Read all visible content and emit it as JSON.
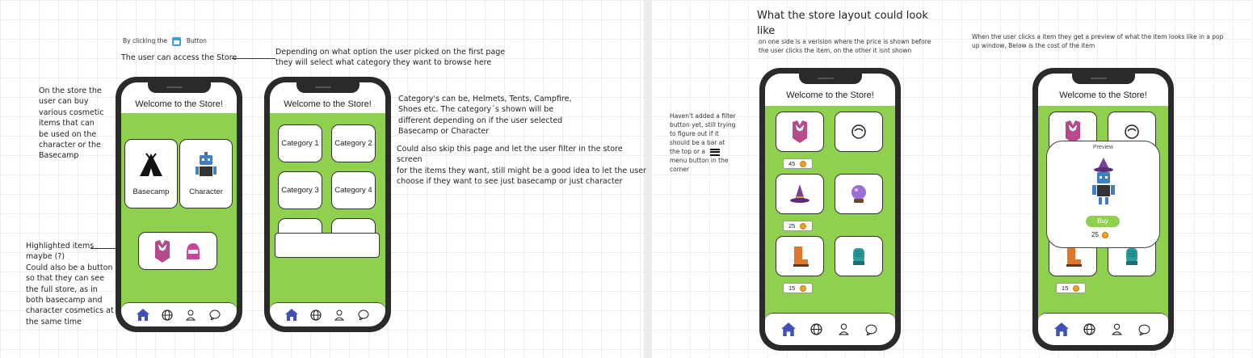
{
  "notes": {
    "by_clicking": "By clicking the",
    "by_clicking_button": "Button",
    "access_store": "The user can access the Store",
    "depending_1": "Depending on what option the user picked on the first page",
    "depending_2": "they will select what category they want to browse here",
    "left_desc": [
      "On the store the",
      "user can buy",
      "various cosmetic",
      "items that can",
      "be used on the",
      "character or the",
      "Basecamp"
    ],
    "category_desc": [
      "Category's can be, Helmets, Tents, Campfire,",
      "Shoes etc. The category´s shown will be",
      "different depending on if the user selected",
      "Basecamp or Character"
    ],
    "skip_desc": [
      "Could also skip this page and let the user filter in the store",
      "screen",
      "for the items they want, still might be a good idea to let the user",
      "choose if they want to see just basecamp or just character"
    ],
    "highlighted": [
      "Highlighted items",
      "maybe (?)",
      "Could also be a button",
      "so that they can see",
      "the full store, as in",
      "both basecamp and",
      "character cosmetics at",
      "the same time"
    ],
    "layout_title_1": "What the store layout could look",
    "layout_title_2": "like",
    "layout_sub": [
      "on one side is a verision where the price is shown before",
      "the user clicks the item, on the other it isnt shown"
    ],
    "popup_desc": [
      "When the user clicks a item they get a preview of what the item looks like in a pop",
      "up window, Below is the cost of the item"
    ],
    "filter_desc": [
      "Haven't added a filter",
      "button yet, still trying",
      "to figure out if it",
      "should be a bar at",
      "the top or a",
      "menu button in the",
      "corner"
    ]
  },
  "store": {
    "welcome": "Welcome to the Store!",
    "basecamp": "Basecamp",
    "character": "Character",
    "categories": [
      "Category 1",
      "Category 2",
      "Category 3",
      "Category 4"
    ],
    "prices": [
      "45",
      "25",
      "15"
    ],
    "preview_title": "Preview",
    "buy": "Buy",
    "preview_price": "25"
  },
  "nav_icons": [
    "home-icon",
    "globe-icon",
    "profile-icon",
    "chat-icon"
  ],
  "colors": {
    "screen_green": "#8fd14f",
    "nav_blue": "#3f51b5",
    "coin": "#f0a020"
  }
}
